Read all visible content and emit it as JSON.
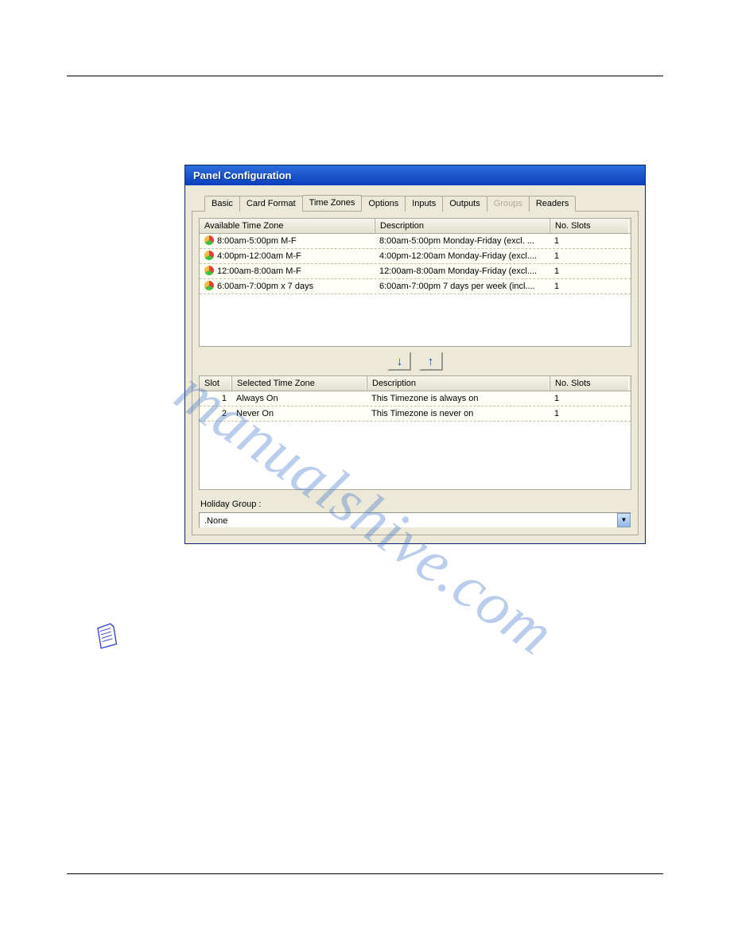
{
  "window": {
    "title": "Panel Configuration"
  },
  "tabs": {
    "basic": "Basic",
    "card_format": "Card Format",
    "time_zones": "Time Zones",
    "options": "Options",
    "inputs": "Inputs",
    "outputs": "Outputs",
    "groups": "Groups",
    "readers": "Readers"
  },
  "available": {
    "headers": {
      "name": "Available Time Zone",
      "desc": "Description",
      "slots": "No. Slots"
    },
    "rows": [
      {
        "name": "8:00am-5:00pm M-F",
        "desc": "8:00am-5:00pm Monday-Friday (excl. ...",
        "slots": "1"
      },
      {
        "name": "4:00pm-12:00am M-F",
        "desc": "4:00pm-12:00am Monday-Friday (excl....",
        "slots": "1"
      },
      {
        "name": "12:00am-8:00am M-F",
        "desc": "12:00am-8:00am Monday-Friday (excl....",
        "slots": "1"
      },
      {
        "name": "6:00am-7:00pm x 7 days",
        "desc": "6:00am-7:00pm 7 days per week (incl....",
        "slots": "1"
      }
    ]
  },
  "selected": {
    "headers": {
      "slot": "Slot",
      "name": "Selected Time Zone",
      "desc": "Description",
      "slots": "No. Slots"
    },
    "rows": [
      {
        "slot": "1",
        "name": "Always On",
        "desc": "This Timezone is always on",
        "slots": "1"
      },
      {
        "slot": "2",
        "name": "Never On",
        "desc": "This Timezone is never on",
        "slots": "1"
      }
    ]
  },
  "buttons": {
    "down": "↓",
    "up": "↑"
  },
  "holiday": {
    "label": "Holiday Group :",
    "value": ".None"
  },
  "watermark": "manualshive.com"
}
